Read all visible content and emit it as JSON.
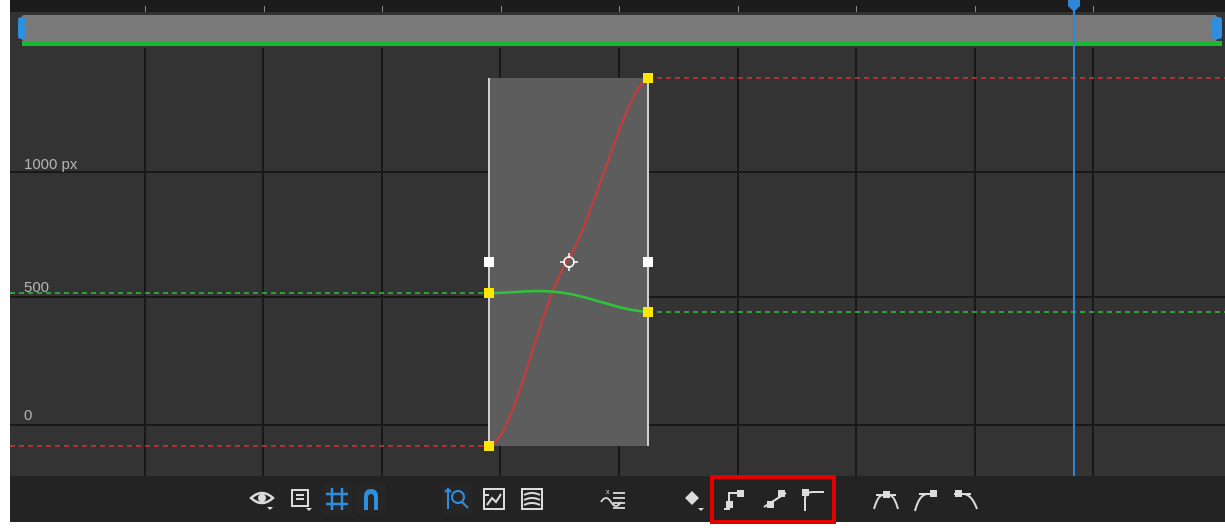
{
  "graph": {
    "y_axis_labels": [
      "1000 px",
      "500",
      "0"
    ],
    "time_ruler_ticks": 9,
    "colors": {
      "background": "#333333",
      "grid": "#181818",
      "ruler": "#1c1c1c",
      "work_area_bar": "#7a7a7a",
      "work_area_handles": "#2e8ee0",
      "green_line": "#16b82e",
      "current_time_indicator": "#2f86d6",
      "red_curve": "#d03838",
      "green_curve": "#2ec43a",
      "keyframe": "#ffe600",
      "selection_box": "#5d5d5d"
    },
    "curves": [
      {
        "property": "y-position",
        "color": "red-curve",
        "from_value": 0,
        "to_value": 1500
      },
      {
        "property": "x-position",
        "color": "green-curve",
        "from_value": 505,
        "to_value": 425
      }
    ]
  },
  "toolbar": {
    "buttons": [
      {
        "name": "show-properties-icon",
        "active": false
      },
      {
        "name": "graph-type-menu-icon",
        "active": false
      },
      {
        "name": "transform-box-icon",
        "active": true
      },
      {
        "name": "snap-icon",
        "active": true
      },
      {
        "name": "auto-zoom-height-icon",
        "active": false
      },
      {
        "name": "fit-selection-icon",
        "active": false
      },
      {
        "name": "fit-all-graphs-icon",
        "active": false
      },
      {
        "name": "separate-dimensions-icon",
        "active": false
      },
      {
        "name": "edit-keyframe-icon",
        "active": false
      },
      {
        "name": "convert-hold-icon",
        "active": false
      },
      {
        "name": "convert-linear-icon",
        "active": false
      },
      {
        "name": "convert-auto-bezier-icon",
        "active": false
      },
      {
        "name": "easy-ease-icon",
        "active": false
      },
      {
        "name": "easy-ease-in-icon",
        "active": false
      },
      {
        "name": "easy-ease-out-icon",
        "active": false
      }
    ],
    "highlight_color": "#e30000",
    "active_color": "#2e8ee0",
    "icon_color": "#dcdcdc"
  }
}
